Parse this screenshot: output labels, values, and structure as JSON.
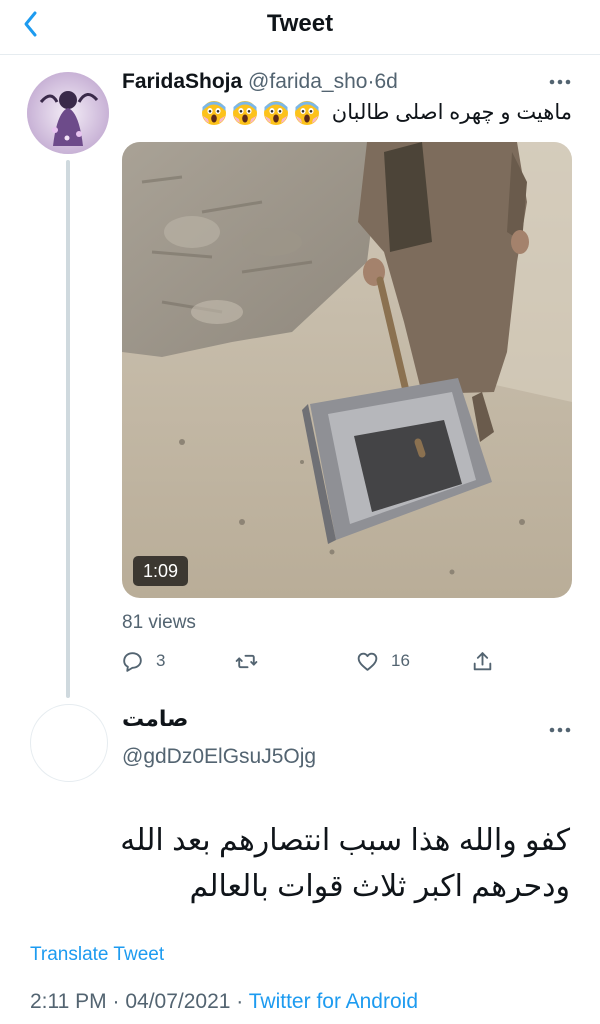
{
  "header": {
    "title": "Tweet",
    "back_icon": "chevron-left-icon",
    "accent_color": "#1d9bf0"
  },
  "tweet": {
    "author_name": "FaridaShoja",
    "handle": "@farida_sho",
    "separator": "·",
    "time": "6d",
    "text": "ماهیت و چهره اصلی طالبان",
    "emojis": [
      "face-screaming-in-fear-icon",
      "face-screaming-in-fear-icon",
      "face-screaming-in-fear-icon",
      "face-screaming-in-fear-icon"
    ],
    "video_duration": "1:09",
    "views": "81 views",
    "actions": {
      "reply_count": "3",
      "retweet_count": "",
      "like_count": "16"
    }
  },
  "reply": {
    "author_name": "صامت",
    "handle": "@gdDz0ElGsuJ5Ojg",
    "text_line1": "كفو والله هذا سبب انتصارهم بعد الله",
    "text_line2": "ودحرهم اكبر ثلاث قوات بالعالم",
    "translate_label": "Translate Tweet",
    "time": "2:11 PM",
    "separator": "·",
    "date": "04/07/2021",
    "source": "Twitter for Android"
  }
}
